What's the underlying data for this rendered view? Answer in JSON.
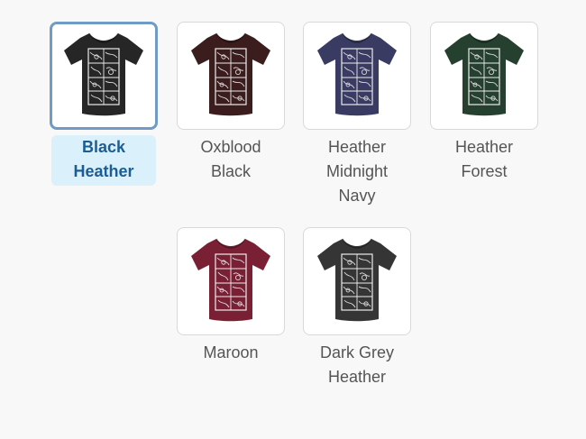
{
  "swatch_grid": {
    "selected_index": 0,
    "swatches": [
      {
        "label": "Black\nHeather",
        "color": "#262626",
        "selected": true
      },
      {
        "label": "Oxblood\nBlack",
        "color": "#3b1d1e",
        "selected": false
      },
      {
        "label": "Heather\nMidnight\nNavy",
        "color": "#3a3b62",
        "selected": false
      },
      {
        "label": "Heather\nForest",
        "color": "#264030",
        "selected": false
      },
      {
        "label": "Maroon",
        "color": "#7a2035",
        "selected": false
      },
      {
        "label": "Dark Grey\nHeather",
        "color": "#353535",
        "selected": false
      }
    ]
  }
}
